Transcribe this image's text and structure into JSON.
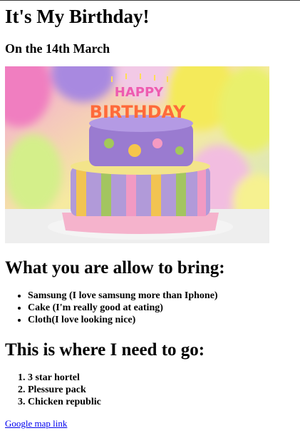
{
  "title": "It's My Birthday!",
  "subtitle": "On the 14th March",
  "image": {
    "alt": "Birthday cake with candles",
    "candle_text": [
      "HAPPY",
      "BIRTHDAY"
    ]
  },
  "bring": {
    "heading": "What you are allow to bring:",
    "items": [
      "Samsung (I love samsung more than Iphone)",
      "Cake (I'm really good at eating)",
      "Cloth(I love looking nice)"
    ]
  },
  "go": {
    "heading": "This is where I need to go:",
    "items": [
      "3 star hortel",
      "Plessure pack",
      "Chicken republic"
    ]
  },
  "link": {
    "label": "Google map link"
  },
  "colors": {
    "link": "#0000ee",
    "cake_top": "#9a7bd0",
    "balloon_pink": "#f07ec0",
    "balloon_yellow": "#f4ea5a"
  }
}
